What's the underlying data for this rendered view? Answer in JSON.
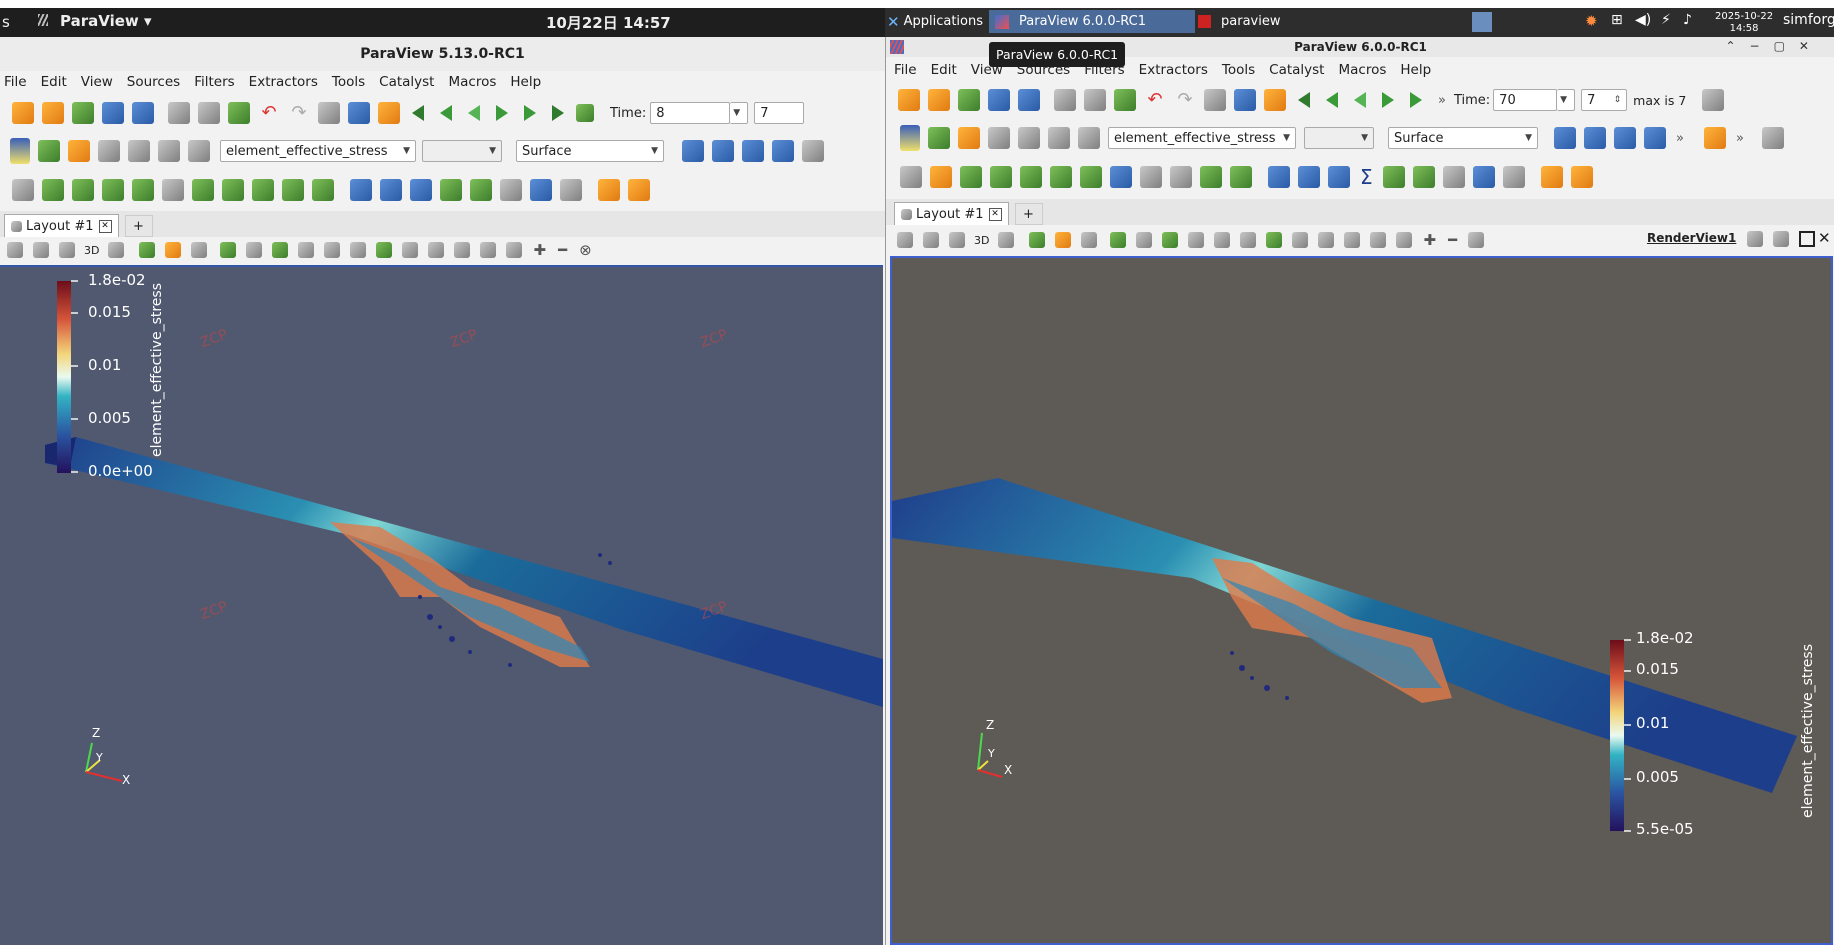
{
  "gnome_bar": {
    "left_text": "s",
    "app_menu": "ParaView ▾",
    "clock": "10月22日 14:57"
  },
  "watermark": "ZCP",
  "left_window": {
    "title": "ParaView 5.13.0-RC1",
    "menu": [
      "File",
      "Edit",
      "View",
      "Sources",
      "Filters",
      "Extractors",
      "Tools",
      "Catalyst",
      "Macros",
      "Help"
    ],
    "time_label": "Time:",
    "time_value": "8",
    "time_index": "7",
    "array_combo": "element_effective_stress",
    "rep_combo": "Surface",
    "tab": "Layout #1",
    "plus": "+",
    "view_3d": "3D",
    "colorbar": {
      "title": "element_effective_stress",
      "ticks": [
        "1.8e-02",
        "0.015",
        "0.01",
        "0.005",
        "0.0e+00"
      ]
    },
    "axes": [
      "Z",
      "Y",
      "X"
    ],
    "bg": "#515970"
  },
  "xfce_bar": {
    "applications": "Applications",
    "tasks": [
      "ParaView 6.0.0-RC1",
      "paraview"
    ],
    "date": "2025-10-22",
    "time": "14:58",
    "user": "simforg"
  },
  "right_window": {
    "title": "ParaView 6.0.0-RC1",
    "tooltip": "ParaView 6.0.0-RC1",
    "menu": [
      "File",
      "Edit",
      "View",
      "Sources",
      "Filters",
      "Extractors",
      "Tools",
      "Catalyst",
      "Macros",
      "Help"
    ],
    "time_label": "Time:",
    "time_value": "70",
    "time_index": "7",
    "max_label": "max is 7",
    "array_combo": "element_effective_stress",
    "rep_combo": "Surface",
    "tab": "Layout #1",
    "plus": "+",
    "view_3d": "3D",
    "render_view": "RenderView1",
    "colorbar": {
      "title": "element_effective_stress",
      "ticks": [
        "1.8e-02",
        "0.015",
        "0.01",
        "0.005",
        "5.5e-05"
      ]
    },
    "axes": [
      "Z",
      "Y",
      "X"
    ],
    "bg": "#5e5a56"
  }
}
